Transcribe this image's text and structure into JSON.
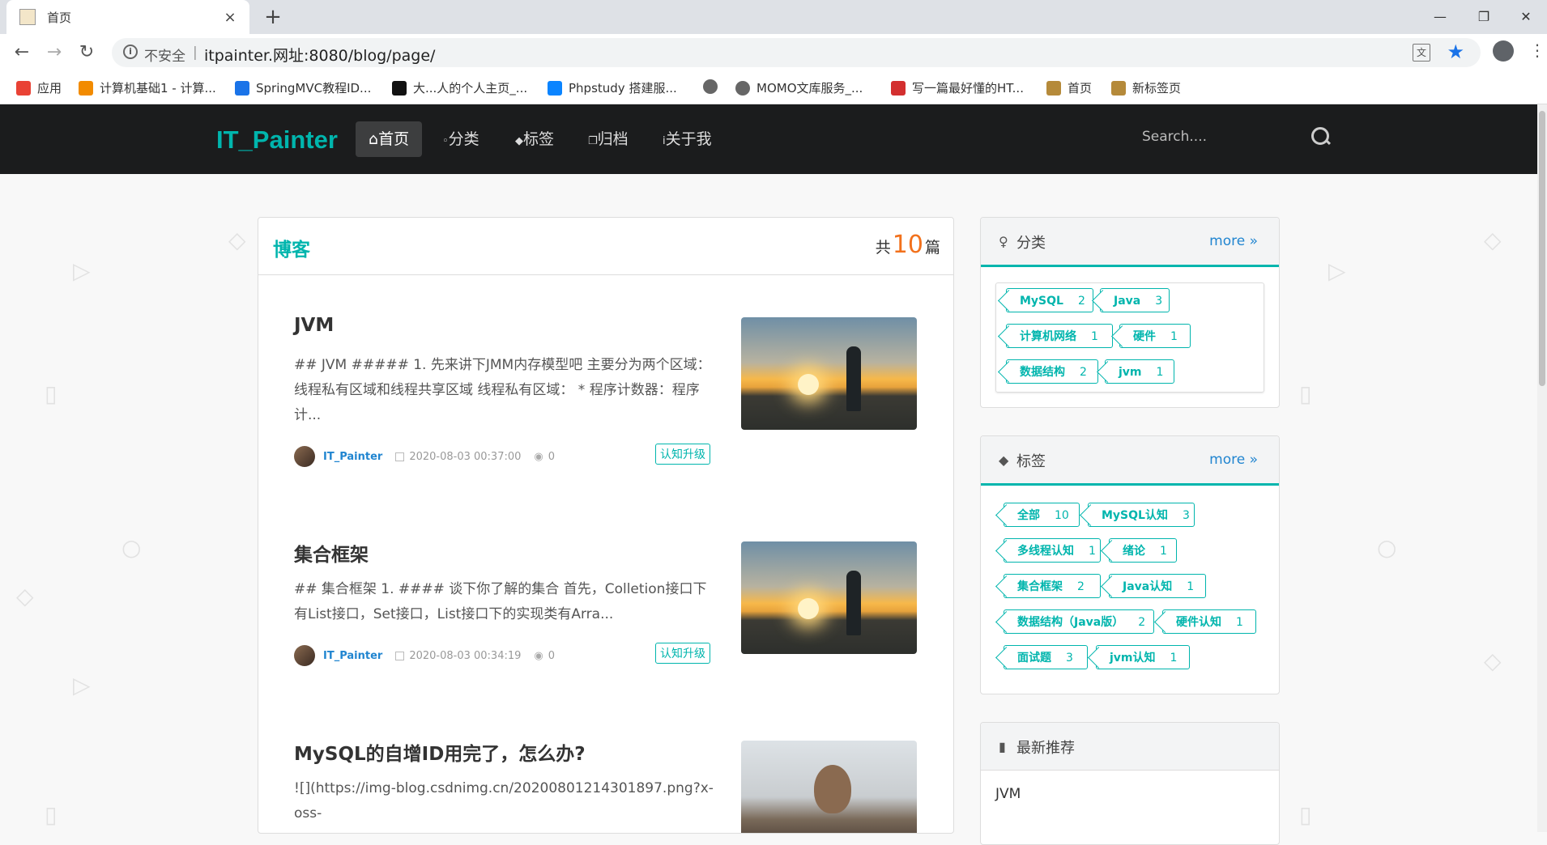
{
  "browser": {
    "tab_title": "首页",
    "tab_close": "×",
    "new_tab": "+",
    "win_minimize": "—",
    "win_restore": "❐",
    "win_close": "✕",
    "insecure_label": "不安全",
    "url": "itpainter.网址:8080/blog/page/",
    "bookmarks": [
      {
        "label": "应用",
        "color": "#e94235"
      },
      {
        "label": "计算机基础1 - 计算...",
        "color": "#f28b00"
      },
      {
        "label": "SpringMVC教程ID...",
        "color": "#1a73e8"
      },
      {
        "label": "大...人的个人主页_...",
        "color": "#111111"
      },
      {
        "label": "Phpstudy 搭建服...",
        "color": "#0a84ff"
      },
      {
        "label": "",
        "color": "#666666"
      },
      {
        "label": "MOMO文库服务_...",
        "color": "#666666"
      },
      {
        "label": "写一篇最好懂的HT...",
        "color": "#d32f2f"
      },
      {
        "label": "首页",
        "color": "#b58a3a"
      },
      {
        "label": "新标签页",
        "color": "#b58a3a"
      }
    ]
  },
  "site": {
    "brand": "IT_Painter",
    "nav": [
      {
        "label": "首页",
        "icon": "home-icon",
        "active": true
      },
      {
        "label": "分类",
        "icon": "lightbulb-icon",
        "active": false
      },
      {
        "label": "标签",
        "icon": "tags-icon",
        "active": false
      },
      {
        "label": "归档",
        "icon": "clone-icon",
        "active": false
      },
      {
        "label": "关于我",
        "icon": "info-icon",
        "active": false
      }
    ],
    "search_placeholder": "Search....",
    "accent": "#00b5ad"
  },
  "blog": {
    "header": "博客",
    "count_prefix": "共",
    "count": "10",
    "count_suffix": "篇",
    "posts": [
      {
        "title": "JVM",
        "excerpt": "## JVM ##### 1. 先来讲下JMM内存模型吧 主要分为两个区域：线程私有区域和线程共享区域 线程私有区域： * 程序计数器：程序计...",
        "author": "IT_Painter",
        "date": "2020-08-03 00:37:00",
        "views": "0",
        "label": "认知升级"
      },
      {
        "title": "集合框架",
        "excerpt": "## 集合框架 1. #### 谈下你了解的集合 首先，Colletion接口下有List接口，Set接口，List接口下的实现类有Arra...",
        "author": "IT_Painter",
        "date": "2020-08-03 00:34:19",
        "views": "0",
        "label": "认知升级"
      },
      {
        "title": "MySQL的自增ID用完了，怎么办?",
        "excerpt": "![](https://img-blog.csdnimg.cn/20200801214301897.png?x-oss-",
        "author": "",
        "date": "",
        "views": "",
        "label": ""
      }
    ]
  },
  "categories": {
    "title": "分类",
    "more": "more »",
    "items": [
      {
        "name": "MySQL",
        "count": "2"
      },
      {
        "name": "Java",
        "count": "3"
      },
      {
        "name": "计算机网络",
        "count": "1"
      },
      {
        "name": "硬件",
        "count": "1"
      },
      {
        "name": "数据结构",
        "count": "2"
      },
      {
        "name": "jvm",
        "count": "1"
      }
    ]
  },
  "tags": {
    "title": "标签",
    "more": "more »",
    "items": [
      {
        "name": "全部",
        "count": "10"
      },
      {
        "name": "MySQL认知",
        "count": "3"
      },
      {
        "name": "多线程认知",
        "count": "1"
      },
      {
        "name": "绪论",
        "count": "1"
      },
      {
        "name": "集合框架",
        "count": "2"
      },
      {
        "name": "Java认知",
        "count": "1"
      },
      {
        "name": "数据结构（Java版）",
        "count": "2"
      },
      {
        "name": "硬件认知",
        "count": "1"
      },
      {
        "name": "面试题",
        "count": "3"
      },
      {
        "name": "jvm认知",
        "count": "1"
      }
    ]
  },
  "recommend": {
    "title": "最新推荐",
    "items": [
      "JVM"
    ]
  }
}
